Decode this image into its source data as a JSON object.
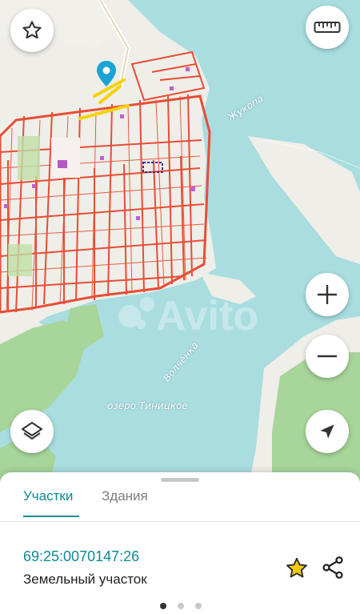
{
  "map": {
    "labels": {
      "river_upper": "Жукопа",
      "river_lower": "Волчёнка",
      "lake": "озеро Тиницкое"
    },
    "watermark": "Avito",
    "colors": {
      "water": "#a9dde0",
      "land": "#efeee8",
      "forest": "#a8d59a",
      "parcel": "#e84d35",
      "highlight": "#3c2a9a"
    }
  },
  "controls": {
    "favorite_icon": "star-outline-icon",
    "ruler_icon": "ruler-icon",
    "zoom_in_icon": "plus-icon",
    "zoom_out_icon": "minus-icon",
    "layers_icon": "layers-icon",
    "locate_icon": "navigation-arrow-icon"
  },
  "sheet": {
    "tabs": [
      {
        "label": "Участки",
        "active": true
      },
      {
        "label": "Здания",
        "active": false
      }
    ],
    "parcel": {
      "cadastral_number": "69:25:0070147:26",
      "type": "Земельный участок"
    },
    "pagination": {
      "total": 3,
      "current": 1
    },
    "accent_color": "#0a8b93",
    "star_color": "#f2c90f"
  }
}
